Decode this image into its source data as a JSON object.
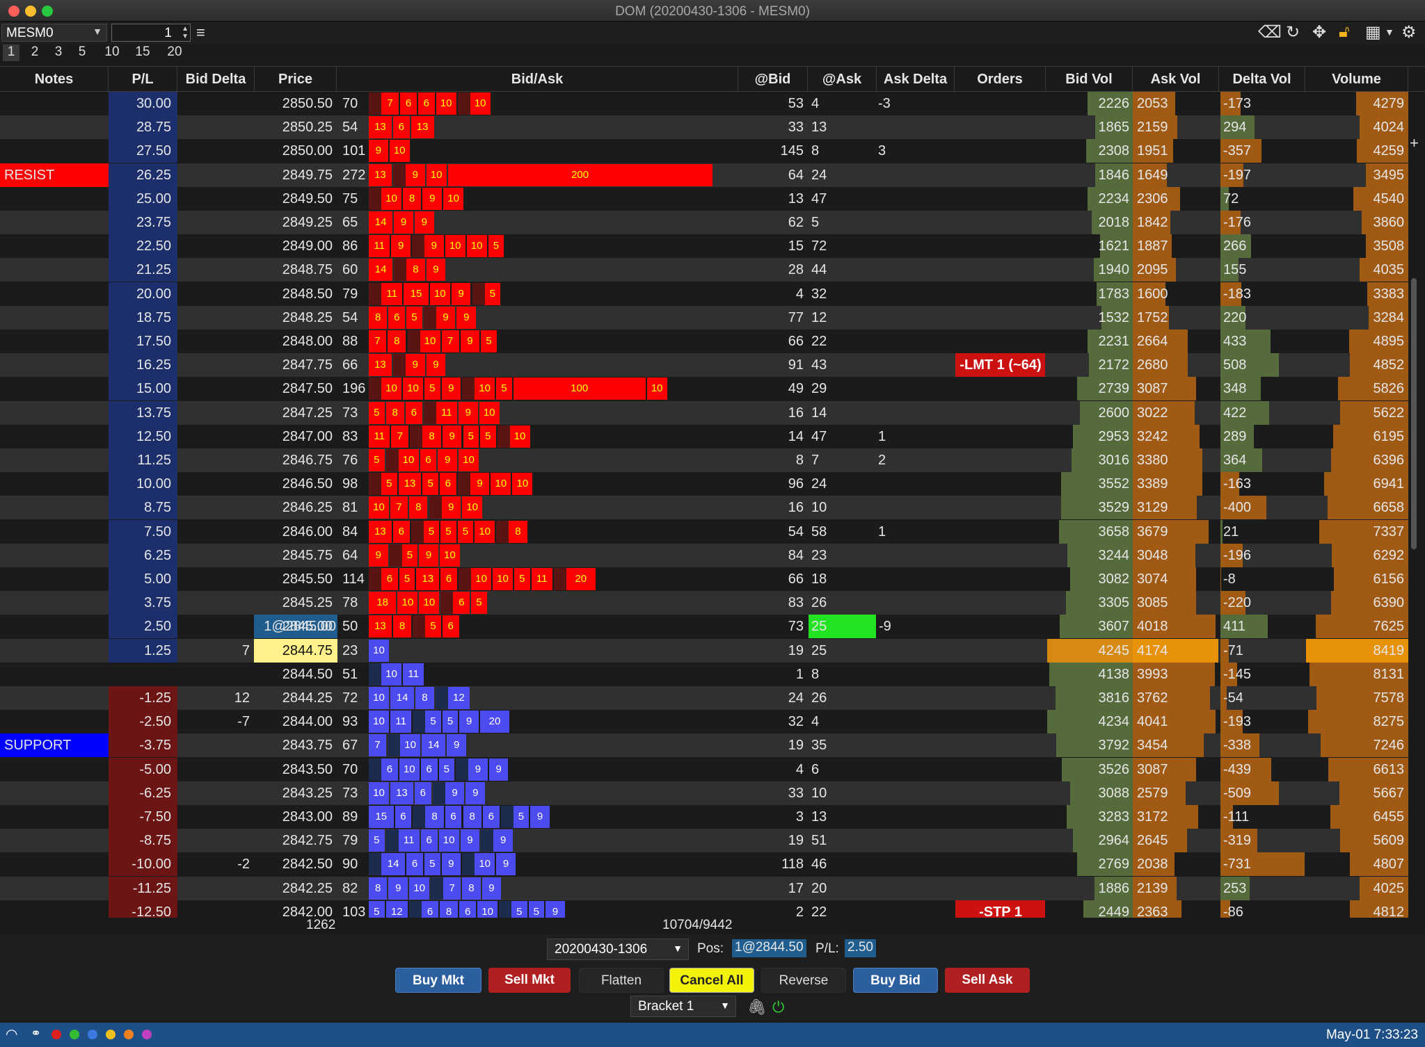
{
  "window": {
    "title": "DOM (20200430-1306 - MESM0)"
  },
  "toolbar": {
    "symbol": "MESM0",
    "quantity": "1",
    "icons": [
      "eraser-icon",
      "refresh-icon",
      "center-icon",
      "lock-open-icon",
      "layout-icon",
      "gear-icon"
    ]
  },
  "quick_sizes": [
    "1",
    "2",
    "3",
    "5",
    "10",
    "15",
    "20"
  ],
  "columns": {
    "notes": "Notes",
    "pl": "P/L",
    "bid_delta": "Bid Delta",
    "price": "Price",
    "bidask": "Bid/Ask",
    "at_bid": "@Bid",
    "at_ask": "@Ask",
    "ask_delta": "Ask Delta",
    "orders": "Orders",
    "bid_vol": "Bid Vol",
    "ask_vol": "Ask Vol",
    "delta_vol": "Delta Vol",
    "volume": "Volume"
  },
  "colors": {
    "resist": "#ff0000",
    "support": "#0000ff",
    "pl_positive": "#1c2f6b",
    "pl_negative": "#6b1515",
    "ask_bar": "#ff0000",
    "bid_bar": "#4b4bf0",
    "order_lmt": "#cc1111",
    "at_ask_highlight": "#22e322",
    "last_price": "#fff28a",
    "position_price": "#1f5d8e"
  },
  "rows": [
    {
      "pl": "30.00",
      "price": "2850.50",
      "n": "70",
      "at_bid": "53",
      "at_ask": "4",
      "ask_delta": "-3",
      "bid_vol": "2226",
      "ask_vol": "2053",
      "delta_vol": "-173",
      "volume": "4279",
      "side": "ask",
      "cells": [
        [
          "7",
          0
        ],
        [
          "6",
          0
        ],
        [
          "6",
          0
        ],
        [
          "10",
          0
        ],
        [
          "10",
          0
        ]
      ]
    },
    {
      "pl": "28.75",
      "price": "2850.25",
      "n": "54",
      "at_bid": "33",
      "at_ask": "13",
      "bid_vol": "1865",
      "ask_vol": "2159",
      "delta_vol": "294",
      "volume": "4024",
      "side": "ask",
      "cells": [
        [
          "13",
          0
        ],
        [
          "6",
          0
        ],
        [
          "13",
          0
        ]
      ]
    },
    {
      "pl": "27.50",
      "price": "2850.00",
      "n": "101",
      "at_bid": "145",
      "at_ask": "8",
      "ask_delta": "3",
      "bid_vol": "2308",
      "ask_vol": "1951",
      "delta_vol": "-357",
      "volume": "4259",
      "side": "ask",
      "cells": [
        [
          "9",
          0
        ],
        [
          "10",
          0
        ]
      ]
    },
    {
      "note": "RESIST",
      "pl": "26.25",
      "price": "2849.75",
      "n": "272",
      "at_bid": "64",
      "at_ask": "24",
      "bid_vol": "1846",
      "ask_vol": "1649",
      "delta_vol": "-197",
      "volume": "3495",
      "side": "ask",
      "cells": [
        [
          "13",
          0
        ],
        [
          "9",
          0
        ],
        [
          "10",
          0
        ],
        [
          "200",
          1
        ]
      ]
    },
    {
      "pl": "25.00",
      "price": "2849.50",
      "n": "75",
      "at_bid": "13",
      "at_ask": "47",
      "bid_vol": "2234",
      "ask_vol": "2306",
      "delta_vol": "72",
      "volume": "4540",
      "side": "ask",
      "cells": [
        [
          "10",
          0
        ],
        [
          "8",
          0
        ],
        [
          "9",
          0
        ],
        [
          "10",
          0
        ]
      ]
    },
    {
      "pl": "23.75",
      "price": "2849.25",
      "n": "65",
      "at_bid": "62",
      "at_ask": "5",
      "bid_vol": "2018",
      "ask_vol": "1842",
      "delta_vol": "-176",
      "volume": "3860",
      "side": "ask",
      "cells": [
        [
          "14",
          0
        ],
        [
          "9",
          0
        ],
        [
          "9",
          0
        ]
      ]
    },
    {
      "pl": "22.50",
      "price": "2849.00",
      "n": "86",
      "at_bid": "15",
      "at_ask": "72",
      "bid_vol": "1621",
      "ask_vol": "1887",
      "delta_vol": "266",
      "volume": "3508",
      "side": "ask",
      "cells": [
        [
          "11",
          0
        ],
        [
          "9",
          0
        ],
        [
          "9",
          0
        ],
        [
          "10",
          0
        ],
        [
          "10",
          0
        ],
        [
          "5",
          0
        ]
      ]
    },
    {
      "pl": "21.25",
      "price": "2848.75",
      "n": "60",
      "at_bid": "28",
      "at_ask": "44",
      "bid_vol": "1940",
      "ask_vol": "2095",
      "delta_vol": "155",
      "volume": "4035",
      "side": "ask",
      "cells": [
        [
          "14",
          0
        ],
        [
          "8",
          0
        ],
        [
          "9",
          0
        ]
      ]
    },
    {
      "pl": "20.00",
      "price": "2848.50",
      "n": "79",
      "at_bid": "4",
      "at_ask": "32",
      "bid_vol": "1783",
      "ask_vol": "1600",
      "delta_vol": "-183",
      "volume": "3383",
      "side": "ask",
      "cells": [
        [
          "11",
          0
        ],
        [
          "15",
          0
        ],
        [
          "10",
          0
        ],
        [
          "9",
          0
        ],
        [
          "5",
          0
        ]
      ]
    },
    {
      "pl": "18.75",
      "price": "2848.25",
      "n": "54",
      "at_bid": "77",
      "at_ask": "12",
      "bid_vol": "1532",
      "ask_vol": "1752",
      "delta_vol": "220",
      "volume": "3284",
      "side": "ask",
      "cells": [
        [
          "8",
          0
        ],
        [
          "6",
          0
        ],
        [
          "5",
          0
        ],
        [
          "9",
          0
        ],
        [
          "9",
          0
        ]
      ]
    },
    {
      "pl": "17.50",
      "price": "2848.00",
      "n": "88",
      "at_bid": "66",
      "at_ask": "22",
      "bid_vol": "2231",
      "ask_vol": "2664",
      "delta_vol": "433",
      "volume": "4895",
      "side": "ask",
      "cells": [
        [
          "7",
          0
        ],
        [
          "8",
          0
        ],
        [
          "10",
          0
        ],
        [
          "7",
          0
        ],
        [
          "9",
          0
        ],
        [
          "5",
          0
        ]
      ]
    },
    {
      "pl": "16.25",
      "price": "2847.75",
      "n": "66",
      "at_bid": "91",
      "at_ask": "43",
      "order": "-LMT 1 (~64)",
      "bid_vol": "2172",
      "ask_vol": "2680",
      "delta_vol": "508",
      "volume": "4852",
      "side": "ask",
      "cells": [
        [
          "13",
          0
        ],
        [
          "9",
          0
        ],
        [
          "9",
          0
        ]
      ]
    },
    {
      "pl": "15.00",
      "price": "2847.50",
      "n": "196",
      "at_bid": "49",
      "at_ask": "29",
      "bid_vol": "2739",
      "ask_vol": "3087",
      "delta_vol": "348",
      "volume": "5826",
      "side": "ask",
      "cells": [
        [
          "10",
          0
        ],
        [
          "10",
          0
        ],
        [
          "5",
          0
        ],
        [
          "9",
          0
        ],
        [
          "10",
          0
        ],
        [
          "5",
          0
        ],
        [
          "100",
          1
        ],
        [
          "10",
          0
        ]
      ]
    },
    {
      "pl": "13.75",
      "price": "2847.25",
      "n": "73",
      "at_bid": "16",
      "at_ask": "14",
      "bid_vol": "2600",
      "ask_vol": "3022",
      "delta_vol": "422",
      "volume": "5622",
      "side": "ask",
      "cells": [
        [
          "5",
          0
        ],
        [
          "8",
          0
        ],
        [
          "6",
          0
        ],
        [
          "11",
          0
        ],
        [
          "9",
          0
        ],
        [
          "10",
          0
        ]
      ]
    },
    {
      "pl": "12.50",
      "price": "2847.00",
      "n": "83",
      "at_bid": "14",
      "at_ask": "47",
      "ask_delta": "1",
      "bid_vol": "2953",
      "ask_vol": "3242",
      "delta_vol": "289",
      "volume": "6195",
      "side": "ask",
      "cells": [
        [
          "11",
          0
        ],
        [
          "7",
          0
        ],
        [
          "8",
          0
        ],
        [
          "9",
          0
        ],
        [
          "5",
          0
        ],
        [
          "5",
          0
        ],
        [
          "10",
          0
        ]
      ]
    },
    {
      "pl": "11.25",
      "price": "2846.75",
      "n": "76",
      "at_bid": "8",
      "at_ask": "7",
      "ask_delta": "2",
      "bid_vol": "3016",
      "ask_vol": "3380",
      "delta_vol": "364",
      "volume": "6396",
      "side": "ask",
      "cells": [
        [
          "5",
          0
        ],
        [
          "10",
          0
        ],
        [
          "6",
          0
        ],
        [
          "9",
          0
        ],
        [
          "10",
          0
        ]
      ]
    },
    {
      "pl": "10.00",
      "price": "2846.50",
      "n": "98",
      "at_bid": "96",
      "at_ask": "24",
      "bid_vol": "3552",
      "ask_vol": "3389",
      "delta_vol": "-163",
      "volume": "6941",
      "side": "ask",
      "cells": [
        [
          "5",
          0
        ],
        [
          "13",
          0
        ],
        [
          "5",
          0
        ],
        [
          "6",
          0
        ],
        [
          "9",
          0
        ],
        [
          "10",
          0
        ],
        [
          "10",
          0
        ]
      ]
    },
    {
      "pl": "8.75",
      "price": "2846.25",
      "n": "81",
      "at_bid": "16",
      "at_ask": "10",
      "bid_vol": "3529",
      "ask_vol": "3129",
      "delta_vol": "-400",
      "volume": "6658",
      "side": "ask",
      "cells": [
        [
          "10",
          0
        ],
        [
          "7",
          0
        ],
        [
          "8",
          0
        ],
        [
          "9",
          0
        ],
        [
          "10",
          0
        ]
      ]
    },
    {
      "pl": "7.50",
      "price": "2846.00",
      "n": "84",
      "at_bid": "54",
      "at_ask": "58",
      "ask_delta": "1",
      "bid_vol": "3658",
      "ask_vol": "3679",
      "delta_vol": "21",
      "volume": "7337",
      "side": "ask",
      "cells": [
        [
          "13",
          0
        ],
        [
          "6",
          0
        ],
        [
          "5",
          0
        ],
        [
          "5",
          0
        ],
        [
          "5",
          0
        ],
        [
          "10",
          0
        ],
        [
          "8",
          0
        ]
      ]
    },
    {
      "pl": "6.25",
      "price": "2845.75",
      "n": "64",
      "at_bid": "84",
      "at_ask": "23",
      "bid_vol": "3244",
      "ask_vol": "3048",
      "delta_vol": "-196",
      "volume": "6292",
      "side": "ask",
      "cells": [
        [
          "9",
          0
        ],
        [
          "5",
          0
        ],
        [
          "9",
          0
        ],
        [
          "10",
          0
        ]
      ]
    },
    {
      "pl": "5.00",
      "price": "2845.50",
      "n": "114",
      "at_bid": "66",
      "at_ask": "18",
      "bid_vol": "3082",
      "ask_vol": "3074",
      "delta_vol": "-8",
      "volume": "6156",
      "side": "ask",
      "cells": [
        [
          "6",
          0
        ],
        [
          "5",
          0
        ],
        [
          "13",
          0
        ],
        [
          "6",
          0
        ],
        [
          "10",
          0
        ],
        [
          "10",
          0
        ],
        [
          "5",
          0
        ],
        [
          "11",
          0
        ],
        [
          "20",
          0
        ]
      ]
    },
    {
      "pl": "3.75",
      "price": "2845.25",
      "n": "78",
      "at_bid": "83",
      "at_ask": "26",
      "bid_vol": "3305",
      "ask_vol": "3085",
      "delta_vol": "-220",
      "volume": "6390",
      "side": "ask",
      "cells": [
        [
          "18",
          0
        ],
        [
          "10",
          0
        ],
        [
          "10",
          0
        ],
        [
          "6",
          0
        ],
        [
          "5",
          0
        ]
      ]
    },
    {
      "pl": "2.50",
      "bid_delta": "1@2845.00",
      "price": "2845.00",
      "n": "50",
      "at_bid": "73",
      "at_ask": "25",
      "ask_delta": "-9",
      "bid_vol": "3607",
      "ask_vol": "4018",
      "delta_vol": "411",
      "volume": "7625",
      "side": "ask",
      "cells": [
        [
          "13",
          0
        ],
        [
          "8",
          0
        ],
        [
          "5",
          0
        ],
        [
          "6",
          0
        ]
      ]
    },
    {
      "pl": "1.25",
      "bid_delta": "7",
      "price": "2844.75",
      "n": "23",
      "at_bid": "19",
      "at_ask": "25",
      "bid_vol": "4245",
      "ask_vol": "4174",
      "delta_vol": "-71",
      "volume": "8419",
      "side": "bid",
      "cells": [
        [
          "10",
          0
        ]
      ]
    },
    {
      "pl": "",
      "price": "2844.50",
      "n": "51",
      "at_bid": "1",
      "at_ask": "8",
      "bid_vol": "4138",
      "ask_vol": "3993",
      "delta_vol": "-145",
      "volume": "8131",
      "side": "bid",
      "cells": [
        [
          "10",
          0
        ],
        [
          "11",
          0
        ]
      ]
    },
    {
      "pl": "-1.25",
      "bid_delta": "12",
      "price": "2844.25",
      "n": "72",
      "at_bid": "24",
      "at_ask": "26",
      "bid_vol": "3816",
      "ask_vol": "3762",
      "delta_vol": "-54",
      "volume": "7578",
      "side": "bid",
      "cells": [
        [
          "10",
          0
        ],
        [
          "14",
          0
        ],
        [
          "8",
          0
        ],
        [
          "12",
          0
        ]
      ]
    },
    {
      "pl": "-2.50",
      "bid_delta": "-7",
      "price": "2844.00",
      "n": "93",
      "at_bid": "32",
      "at_ask": "4",
      "bid_vol": "4234",
      "ask_vol": "4041",
      "delta_vol": "-193",
      "volume": "8275",
      "side": "bid",
      "cells": [
        [
          "10",
          0
        ],
        [
          "11",
          0
        ],
        [
          "5",
          0
        ],
        [
          "5",
          0
        ],
        [
          "9",
          0
        ],
        [
          "20",
          0
        ]
      ]
    },
    {
      "note": "SUPPORT",
      "pl": "-3.75",
      "price": "2843.75",
      "n": "67",
      "at_bid": "19",
      "at_ask": "35",
      "bid_vol": "3792",
      "ask_vol": "3454",
      "delta_vol": "-338",
      "volume": "7246",
      "side": "bid",
      "cells": [
        [
          "7",
          0
        ],
        [
          "10",
          0
        ],
        [
          "14",
          0
        ],
        [
          "9",
          0
        ]
      ]
    },
    {
      "pl": "-5.00",
      "price": "2843.50",
      "n": "70",
      "at_bid": "4",
      "at_ask": "6",
      "bid_vol": "3526",
      "ask_vol": "3087",
      "delta_vol": "-439",
      "volume": "6613",
      "side": "bid",
      "cells": [
        [
          "6",
          0
        ],
        [
          "10",
          0
        ],
        [
          "6",
          0
        ],
        [
          "5",
          0
        ],
        [
          "9",
          0
        ],
        [
          "9",
          0
        ]
      ]
    },
    {
      "pl": "-6.25",
      "price": "2843.25",
      "n": "73",
      "at_bid": "33",
      "at_ask": "10",
      "bid_vol": "3088",
      "ask_vol": "2579",
      "delta_vol": "-509",
      "volume": "5667",
      "side": "bid",
      "cells": [
        [
          "10",
          0
        ],
        [
          "13",
          0
        ],
        [
          "6",
          0
        ],
        [
          "9",
          0
        ],
        [
          "9",
          0
        ]
      ]
    },
    {
      "pl": "-7.50",
      "price": "2843.00",
      "n": "89",
      "at_bid": "3",
      "at_ask": "13",
      "bid_vol": "3283",
      "ask_vol": "3172",
      "delta_vol": "-111",
      "volume": "6455",
      "side": "bid",
      "cells": [
        [
          "15",
          0
        ],
        [
          "6",
          0
        ],
        [
          "8",
          0
        ],
        [
          "6",
          0
        ],
        [
          "8",
          0
        ],
        [
          "6",
          0
        ],
        [
          "5",
          0
        ],
        [
          "9",
          0
        ]
      ]
    },
    {
      "pl": "-8.75",
      "price": "2842.75",
      "n": "79",
      "at_bid": "19",
      "at_ask": "51",
      "bid_vol": "2964",
      "ask_vol": "2645",
      "delta_vol": "-319",
      "volume": "5609",
      "side": "bid",
      "cells": [
        [
          "5",
          0
        ],
        [
          "11",
          0
        ],
        [
          "6",
          0
        ],
        [
          "10",
          0
        ],
        [
          "9",
          0
        ],
        [
          "9",
          0
        ]
      ]
    },
    {
      "pl": "-10.00",
      "bid_delta": "-2",
      "price": "2842.50",
      "n": "90",
      "at_bid": "118",
      "at_ask": "46",
      "bid_vol": "2769",
      "ask_vol": "2038",
      "delta_vol": "-731",
      "volume": "4807",
      "side": "bid",
      "cells": [
        [
          "14",
          0
        ],
        [
          "6",
          0
        ],
        [
          "5",
          0
        ],
        [
          "9",
          0
        ],
        [
          "10",
          0
        ],
        [
          "9",
          0
        ]
      ]
    },
    {
      "pl": "-11.25",
      "price": "2842.25",
      "n": "82",
      "at_bid": "17",
      "at_ask": "20",
      "bid_vol": "1886",
      "ask_vol": "2139",
      "delta_vol": "253",
      "volume": "4025",
      "side": "bid",
      "cells": [
        [
          "8",
          0
        ],
        [
          "9",
          0
        ],
        [
          "10",
          0
        ],
        [
          "7",
          0
        ],
        [
          "8",
          0
        ],
        [
          "9",
          0
        ]
      ]
    },
    {
      "pl": "-12.50",
      "price": "2842.00",
      "n": "103",
      "at_bid": "2",
      "at_ask": "22",
      "order": "-STP 1",
      "bid_vol": "2449",
      "ask_vol": "2363",
      "delta_vol": "-86",
      "volume": "4812",
      "side": "bid",
      "cells": [
        [
          "5",
          0
        ],
        [
          "12",
          0
        ],
        [
          "6",
          0
        ],
        [
          "8",
          0
        ],
        [
          "6",
          0
        ],
        [
          "10",
          0
        ],
        [
          "5",
          0
        ],
        [
          "5",
          0
        ],
        [
          "9",
          0
        ]
      ]
    }
  ],
  "totals": {
    "bid_delta": "1262",
    "bidask": "10704/9442"
  },
  "bottom": {
    "session": "20200430-1306",
    "pos_label": "Pos:",
    "pos_value": "1@2844.50",
    "pl_label": "P/L:",
    "pl_value": "2.50",
    "buttons": {
      "buy_mkt": "Buy Mkt",
      "sell_mkt": "Sell Mkt",
      "flatten": "Flatten",
      "cancel_all": "Cancel All",
      "reverse": "Reverse",
      "buy_bid": "Buy Bid",
      "sell_ask": "Sell Ask"
    },
    "bracket": "Bracket 1"
  },
  "status": {
    "clock": "May-01 7:33:23"
  }
}
